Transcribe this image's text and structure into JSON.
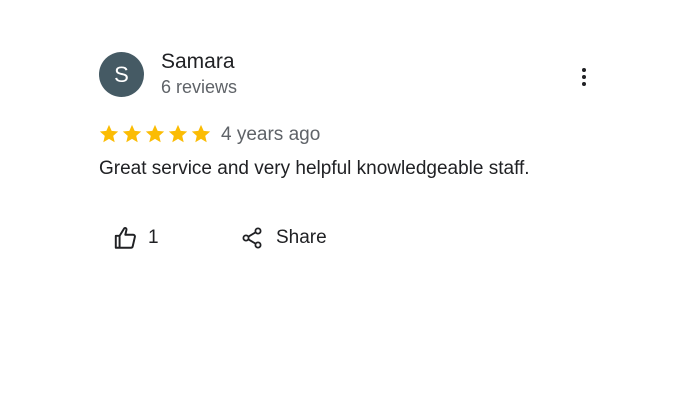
{
  "review": {
    "reviewer": {
      "initial": "S",
      "name": "Samara",
      "review_count": "6 reviews",
      "avatar_color": "#455a64"
    },
    "rating": 5,
    "max_rating": 5,
    "star_color": "#fbbc04",
    "date": "4 years ago",
    "text": "Great service and very helpful knowledgeable staff.",
    "actions": {
      "like_count": "1",
      "share_label": "Share"
    },
    "icons": {
      "more": "more-vert-icon",
      "like": "thumb-up-icon",
      "share": "share-icon",
      "star": "star-icon"
    }
  }
}
